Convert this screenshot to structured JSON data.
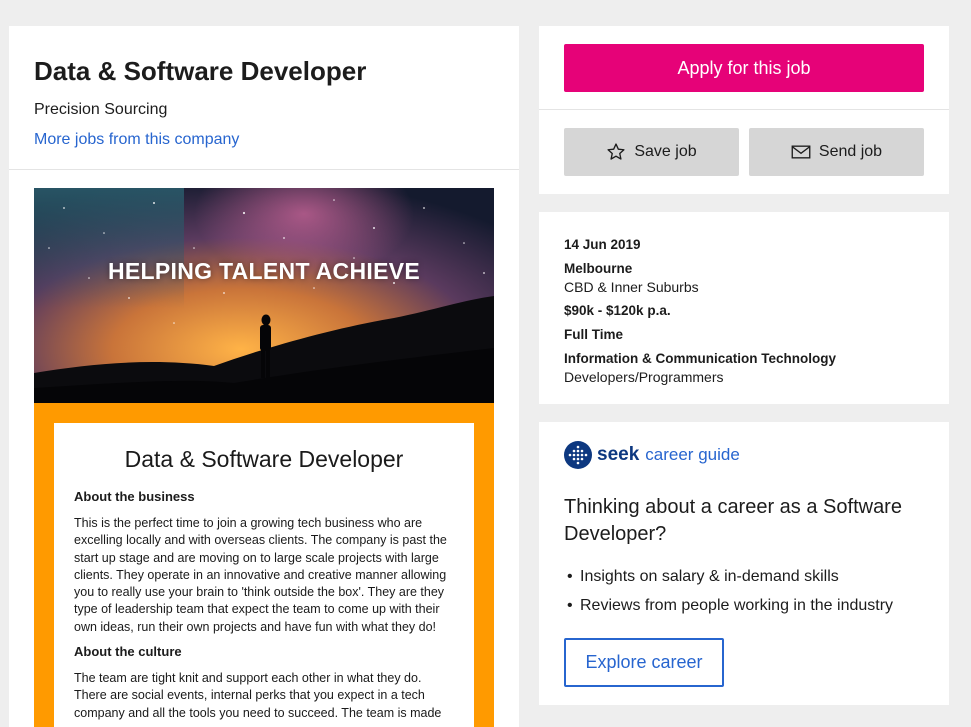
{
  "job": {
    "title": "Data & Software Developer",
    "company": "Precision Sourcing",
    "more_jobs_link": "More jobs from this company"
  },
  "banner": {
    "text": "HELPING TALENT ACHIEVE"
  },
  "ad": {
    "title": "Data & Software Developer",
    "sections": [
      {
        "heading": "About the business",
        "body": "This is the perfect time to join a growing tech business who are excelling locally and with overseas clients. The company is past the start up stage and are moving on to large scale projects with large clients. They operate in an innovative and creative manner allowing you to really use your brain to 'think outside the box'. They are they type of leadership team that expect the team to come up with their own ideas, run their own projects and have fun with what they do!"
      },
      {
        "heading": "About the culture",
        "body": "The team are tight knit and support each other in what they do. There are social events, internal perks that you expect in a tech company and all the tools you need to succeed. The team is made"
      }
    ]
  },
  "actions": {
    "apply_label": "Apply for this job",
    "save_label": "Save job",
    "send_label": "Send job"
  },
  "details": {
    "date": "14 Jun 2019",
    "location": "Melbourne",
    "area": "CBD & Inner Suburbs",
    "salary": "$90k - $120k p.a.",
    "work_type": "Full Time",
    "classification": "Information & Communication Technology",
    "subclassification": "Developers/Programmers"
  },
  "career_guide": {
    "brand": "seek",
    "product": "career guide",
    "question": "Thinking about a career as a Software Developer?",
    "bullets": [
      "Insights on salary & in-demand skills",
      "Reviews from people working in the industry"
    ],
    "explore_label": "Explore career"
  },
  "colors": {
    "apply": "#e60278",
    "link": "#2765cf",
    "ad_frame": "#ff9a00",
    "seek_navy": "#0d3880"
  },
  "icons": {
    "save": "star-icon",
    "send": "envelope-icon",
    "brand": "seek-logo-icon"
  }
}
